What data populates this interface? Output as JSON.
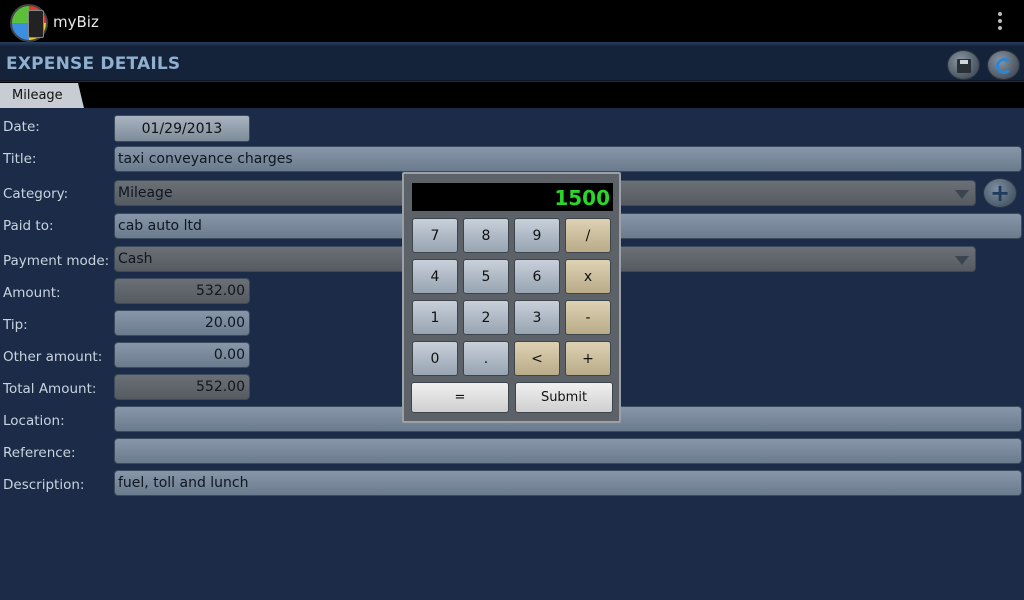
{
  "app": {
    "title": "myBiz",
    "icon": "app-logo-icon"
  },
  "header": {
    "title": "EXPENSE DETAILS",
    "save_icon": "save-icon",
    "refresh_icon": "refresh-icon"
  },
  "tab": {
    "label": "Mileage"
  },
  "form": {
    "date_label": "Date:",
    "date_value": "01/29/2013",
    "title_label": "Title:",
    "title_value": "taxi conveyance charges",
    "category_label": "Category:",
    "category_value": "Mileage",
    "paidto_label": "Paid to:",
    "paidto_value": "cab auto ltd",
    "payment_label": "Payment mode:",
    "payment_value": "Cash",
    "amount_label": "Amount:",
    "amount_value": "532.00",
    "tip_label": "Tip:",
    "tip_value": "20.00",
    "other_label": "Other amount:",
    "other_value": "0.00",
    "total_label": "Total Amount:",
    "total_value": "552.00",
    "location_label": "Location:",
    "location_value": "",
    "reference_label": "Reference:",
    "reference_value": "",
    "description_label": "Description:",
    "description_value": "fuel, toll and lunch"
  },
  "calculator": {
    "display": "1500",
    "keys": [
      "7",
      "8",
      "9",
      "/",
      "4",
      "5",
      "6",
      "x",
      "1",
      "2",
      "3",
      "-",
      "0",
      ".",
      "<",
      "+"
    ],
    "equals_label": "=",
    "submit_label": "Submit"
  },
  "colors": {
    "display_text": "#2bd62b",
    "header_title": "#8fb0cf",
    "background": "#1b2b48"
  }
}
